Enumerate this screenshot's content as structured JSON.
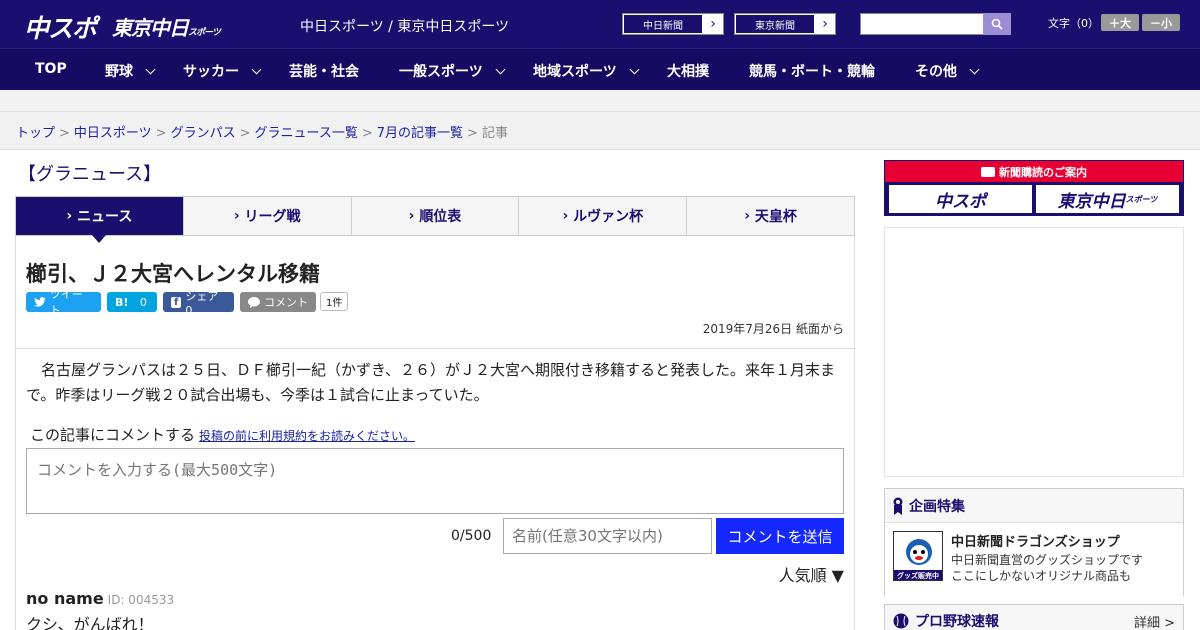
{
  "header": {
    "logo_chunichi_sports": "中スポ",
    "logo_tokyo_chunichi_main": "東京中日",
    "logo_tokyo_chunichi_sub": "スポーツ",
    "site_title": "中日スポーツ / 東京中日スポーツ",
    "paper_links": [
      "中日新聞",
      "東京新聞"
    ],
    "search_placeholder": "",
    "font_size_label": "文字（0）",
    "font_larger": "＋大",
    "font_smaller": "－小"
  },
  "nav": [
    {
      "label": "TOP",
      "dropdown": false
    },
    {
      "label": "野球",
      "dropdown": true
    },
    {
      "label": "サッカー",
      "dropdown": true
    },
    {
      "label": "芸能・社会",
      "dropdown": false
    },
    {
      "label": "一般スポーツ",
      "dropdown": true
    },
    {
      "label": "地域スポーツ",
      "dropdown": true
    },
    {
      "label": "大相撲",
      "dropdown": false
    },
    {
      "label": "競馬・ボート・競輪",
      "dropdown": false
    },
    {
      "label": "その他",
      "dropdown": true
    }
  ],
  "breadcrumb": [
    "トップ",
    "中日スポーツ",
    "グランパス",
    "グラニュース一覧",
    "7月の記事一覧",
    "記事"
  ],
  "breadcrumb_separator": ">",
  "section_title": "【グラニュース】",
  "tabs": [
    "ニュース",
    "リーグ戦",
    "順位表",
    "ルヴァン杯",
    "天皇杯"
  ],
  "article": {
    "headline": "櫛引、Ｊ２大宮へレンタル移籍",
    "social": {
      "tweet": "ツイート",
      "hatena": "0",
      "facebook": "シェア 0",
      "comment": "コメント",
      "comment_count": "1件"
    },
    "date": "2019年7月26日 紙面から",
    "body": "　名古屋グランパスは２５日、ＤＦ櫛引一紀（かずき、２６）がＪ２大宮へ期限付き移籍すると発表した。来年１月末まで。昨季はリーグ戦２０試合出場も、今季は１試合に止まっていた。"
  },
  "comments": {
    "heading": "この記事にコメントする",
    "terms_link": "投稿の前に利用規約をお読みください。",
    "textarea_placeholder": "コメントを入力する(最大500文字)",
    "char_count": "0/500",
    "name_placeholder": "名前(任意30文字以内)",
    "submit_label": "コメントを送信",
    "sort_label": "人気順 ▼",
    "items": [
      {
        "name": "no name",
        "id": "ID: 004533",
        "text": "クシ、がんばれ！"
      }
    ]
  },
  "sidebar": {
    "subscribe_heading": "新聞購読のご案内",
    "subscribe_logos": [
      "中スポ",
      "東京中日"
    ],
    "subscribe_logo_suffix": "スポーツ",
    "featured_heading": "企画特集",
    "featured_item": {
      "title": "中日新聞ドラゴンズショップ",
      "desc_1": "中日新聞直営のグッズショップです",
      "desc_2": "ここにしかないオリジナル商品も",
      "badge": "グッズ販売中"
    },
    "baseball_heading": "プロ野球速報",
    "baseball_more": "詳細 >"
  },
  "colors": {
    "brand_navy": "#1a0e6e",
    "submit_blue": "#1428ff",
    "subscribe_red": "#e60033"
  }
}
